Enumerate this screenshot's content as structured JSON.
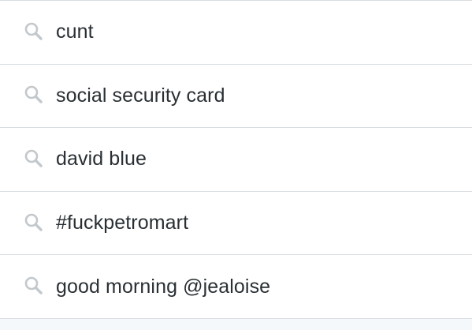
{
  "recent_searches": {
    "items": [
      {
        "label": "cunt",
        "icon": "search-icon"
      },
      {
        "label": "social security card",
        "icon": "search-icon"
      },
      {
        "label": "david blue",
        "icon": "search-icon"
      },
      {
        "label": "#fuckpetromart",
        "icon": "search-icon"
      },
      {
        "label": "good morning @jealoise",
        "icon": "search-icon"
      }
    ]
  },
  "colors": {
    "text": "#292f33",
    "icon": "#c3c8cc",
    "divider": "#d9dde1",
    "background": "#ffffff",
    "footer": "#f5f8fa"
  }
}
